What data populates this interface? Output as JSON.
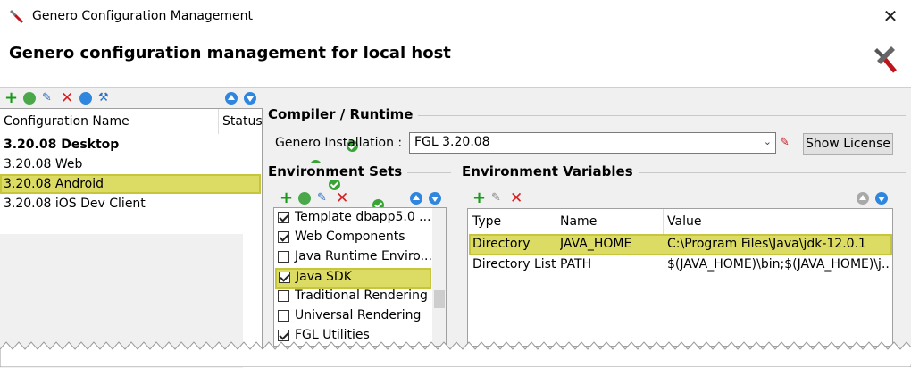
{
  "window": {
    "title": "Genero Configuration Management"
  },
  "header": {
    "title": "Genero configuration management for local host"
  },
  "configurations": {
    "columns": {
      "name": "Configuration Name",
      "status": "Status"
    },
    "rows": [
      {
        "name": "3.20.08 Desktop",
        "bold": true
      },
      {
        "name": "3.20.08 Web"
      },
      {
        "name": "3.20.08 Android",
        "selected": true
      },
      {
        "name": "3.20.08 iOS Dev Client"
      }
    ]
  },
  "compiler": {
    "section": "Compiler / Runtime",
    "installation_label": "Genero Installation :",
    "installation_value": "FGL 3.20.08",
    "show_license": "Show License"
  },
  "env_sets": {
    "section": "Environment Sets",
    "items": [
      {
        "label": "Template dbapp5.0 ...",
        "checked": true
      },
      {
        "label": "Web Components",
        "checked": true
      },
      {
        "label": "Java Runtime Enviro...",
        "checked": false
      },
      {
        "label": "Java SDK",
        "checked": true
      },
      {
        "label": "Traditional Rendering",
        "checked": false
      },
      {
        "label": "Universal Rendering",
        "checked": false
      },
      {
        "label": "FGL Utilities",
        "checked": true
      }
    ]
  },
  "env_vars": {
    "section": "Environment Variables",
    "columns": {
      "type": "Type",
      "name": "Name",
      "value": "Value"
    },
    "rows": [
      {
        "type": "Directory",
        "name": "JAVA_HOME",
        "value": "C:\\Program Files\\Java\\jdk-12.0.1"
      },
      {
        "type": "Directory List",
        "name": "PATH",
        "value": "$(JAVA_HOME)\\bin;$(JAVA_HOME)\\j..."
      }
    ]
  },
  "colors": {
    "highlight": "#dcdc64",
    "accent_blue": "#2f86de",
    "add_green": "#1a9a1a",
    "delete_red": "#d42020"
  }
}
